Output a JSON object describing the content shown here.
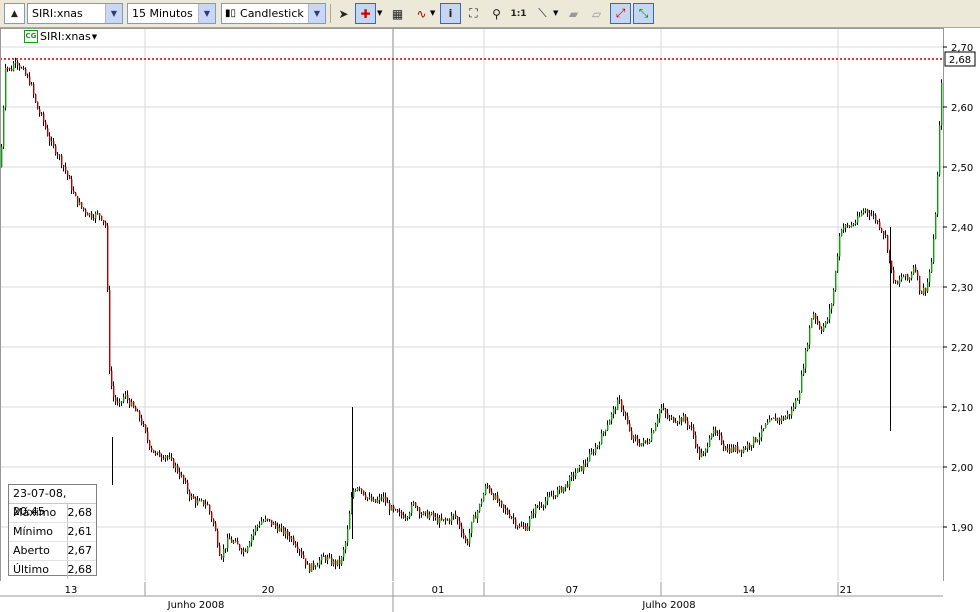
{
  "toolbar": {
    "symbol": "SIRI:xnas",
    "interval": "15 Minutos",
    "chart_type": "Candlestick",
    "icons": [
      "collapse-up-icon",
      "pointer-icon",
      "crosshair-icon",
      "grid-icon",
      "indicator-wave-icon",
      "info-icon",
      "zoom-box-icon",
      "zoom-icon",
      "zoom-reset-icon",
      "line-draw-icon",
      "eraser-icon",
      "eraser-all-icon",
      "auto-scale-icon",
      "scroll-icon"
    ],
    "zoom_reset_label": "1:1"
  },
  "symbol_tag": {
    "badge": "CG",
    "label": "SIRI:xnas"
  },
  "info_box": {
    "timestamp": "23-07-08, 20:45",
    "rows": [
      {
        "label": "Máximo",
        "value": "2,68"
      },
      {
        "label": "Mínimo",
        "value": "2,61"
      },
      {
        "label": "Aberto",
        "value": "2,67"
      },
      {
        "label": "Último",
        "value": "2,68"
      }
    ]
  },
  "colors": {
    "up": "#0f9f0f",
    "down": "#b20000",
    "wick": "#000000",
    "grid": "#d8d8d8",
    "price_line": "#cc0000"
  },
  "chart_data": {
    "type": "candlestick",
    "title": "",
    "ylim": [
      1.81,
      2.73
    ],
    "yticks": [
      "2,70",
      "2,60",
      "2,50",
      "2,40",
      "2,30",
      "2,20",
      "2,10",
      "2,00",
      "1,90"
    ],
    "x_day_labels": [
      "13",
      "20",
      "01",
      "07",
      "14",
      "21"
    ],
    "x_month_labels": [
      "Junho 2008",
      "Julho 2008"
    ],
    "last_price_label": "2,68",
    "last_price": 2.68,
    "price_path": [
      [
        0,
        2.5
      ],
      [
        5,
        2.67
      ],
      [
        10,
        2.66
      ],
      [
        15,
        2.68
      ],
      [
        22,
        2.66
      ],
      [
        30,
        2.64
      ],
      [
        36,
        2.6
      ],
      [
        42,
        2.58
      ],
      [
        50,
        2.54
      ],
      [
        58,
        2.52
      ],
      [
        66,
        2.49
      ],
      [
        74,
        2.45
      ],
      [
        82,
        2.43
      ],
      [
        90,
        2.42
      ],
      [
        100,
        2.42
      ],
      [
        106,
        2.4
      ],
      [
        108,
        2.18
      ],
      [
        112,
        2.12
      ],
      [
        118,
        2.1
      ],
      [
        124,
        2.12
      ],
      [
        132,
        2.1
      ],
      [
        140,
        2.08
      ],
      [
        148,
        2.04
      ],
      [
        155,
        2.02
      ],
      [
        165,
        2.02
      ],
      [
        175,
        2.0
      ],
      [
        182,
        1.98
      ],
      [
        190,
        1.95
      ],
      [
        198,
        1.94
      ],
      [
        206,
        1.94
      ],
      [
        214,
        1.9
      ],
      [
        220,
        1.85
      ],
      [
        228,
        1.88
      ],
      [
        236,
        1.87
      ],
      [
        244,
        1.86
      ],
      [
        252,
        1.89
      ],
      [
        260,
        1.91
      ],
      [
        268,
        1.91
      ],
      [
        276,
        1.9
      ],
      [
        284,
        1.89
      ],
      [
        292,
        1.88
      ],
      [
        300,
        1.86
      ],
      [
        308,
        1.83
      ],
      [
        316,
        1.84
      ],
      [
        324,
        1.85
      ],
      [
        332,
        1.84
      ],
      [
        340,
        1.84
      ],
      [
        346,
        1.88
      ],
      [
        352,
        1.96
      ],
      [
        358,
        1.97
      ],
      [
        366,
        1.95
      ],
      [
        374,
        1.94
      ],
      [
        382,
        1.95
      ],
      [
        390,
        1.93
      ],
      [
        398,
        1.92
      ],
      [
        406,
        1.92
      ],
      [
        414,
        1.94
      ],
      [
        422,
        1.92
      ],
      [
        430,
        1.92
      ],
      [
        438,
        1.91
      ],
      [
        446,
        1.91
      ],
      [
        454,
        1.92
      ],
      [
        460,
        1.9
      ],
      [
        466,
        1.87
      ],
      [
        472,
        1.91
      ],
      [
        478,
        1.93
      ],
      [
        486,
        1.97
      ],
      [
        494,
        1.95
      ],
      [
        502,
        1.93
      ],
      [
        510,
        1.92
      ],
      [
        518,
        1.9
      ],
      [
        526,
        1.9
      ],
      [
        534,
        1.93
      ],
      [
        542,
        1.94
      ],
      [
        550,
        1.95
      ],
      [
        558,
        1.96
      ],
      [
        566,
        1.97
      ],
      [
        574,
        1.99
      ],
      [
        582,
        2.0
      ],
      [
        590,
        2.02
      ],
      [
        598,
        2.04
      ],
      [
        606,
        2.07
      ],
      [
        612,
        2.09
      ],
      [
        618,
        2.11
      ],
      [
        624,
        2.09
      ],
      [
        630,
        2.05
      ],
      [
        638,
        2.04
      ],
      [
        646,
        2.04
      ],
      [
        652,
        2.06
      ],
      [
        660,
        2.1
      ],
      [
        668,
        2.08
      ],
      [
        676,
        2.08
      ],
      [
        684,
        2.08
      ],
      [
        692,
        2.06
      ],
      [
        698,
        2.02
      ],
      [
        704,
        2.02
      ],
      [
        710,
        2.06
      ],
      [
        718,
        2.05
      ],
      [
        726,
        2.03
      ],
      [
        734,
        2.03
      ],
      [
        742,
        2.03
      ],
      [
        750,
        2.04
      ],
      [
        758,
        2.05
      ],
      [
        766,
        2.07
      ],
      [
        774,
        2.08
      ],
      [
        782,
        2.08
      ],
      [
        790,
        2.09
      ],
      [
        798,
        2.12
      ],
      [
        806,
        2.2
      ],
      [
        812,
        2.26
      ],
      [
        820,
        2.23
      ],
      [
        826,
        2.24
      ],
      [
        832,
        2.28
      ],
      [
        836,
        2.34
      ],
      [
        840,
        2.4
      ],
      [
        848,
        2.4
      ],
      [
        856,
        2.41
      ],
      [
        864,
        2.43
      ],
      [
        872,
        2.42
      ],
      [
        880,
        2.4
      ],
      [
        886,
        2.38
      ],
      [
        890,
        2.33
      ],
      [
        896,
        2.3
      ],
      [
        902,
        2.32
      ],
      [
        908,
        2.31
      ],
      [
        914,
        2.34
      ],
      [
        920,
        2.29
      ],
      [
        926,
        2.3
      ],
      [
        932,
        2.35
      ],
      [
        936,
        2.45
      ],
      [
        938,
        2.52
      ],
      [
        940,
        2.61
      ],
      [
        942,
        2.68
      ]
    ]
  }
}
